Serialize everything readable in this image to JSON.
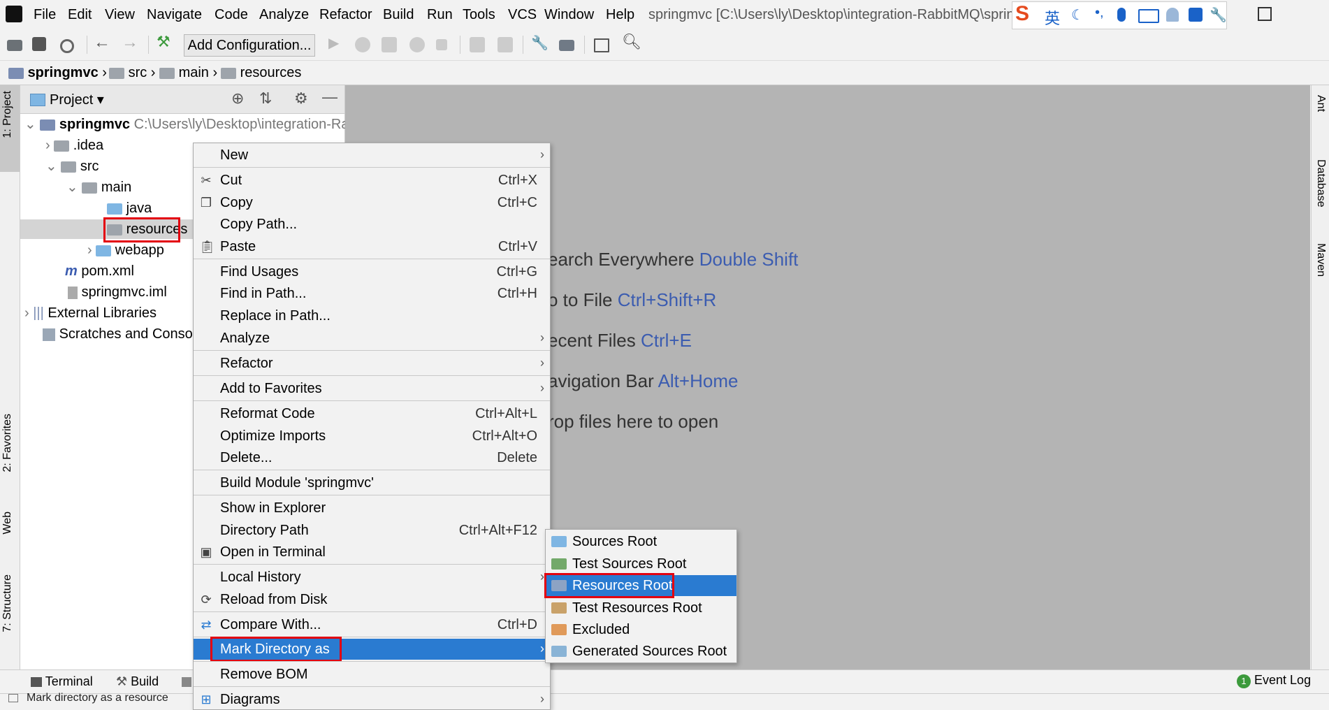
{
  "menubar": {
    "items": [
      "File",
      "Edit",
      "View",
      "Navigate",
      "Code",
      "Analyze",
      "Refactor",
      "Build",
      "Run",
      "Tools",
      "VCS",
      "Window",
      "Help"
    ],
    "window_title": "springmvc [C:\\Users\\ly\\Desktop\\integration-RabbitMQ\\sprin",
    "ime": {
      "logo": "S",
      "lang": "英"
    }
  },
  "toolbar": {
    "add_configuration": "Add Configuration..."
  },
  "breadcrumb": [
    "springmvc",
    "src",
    "main",
    "resources"
  ],
  "project_panel": {
    "title": "Project",
    "tree": {
      "root": "springmvc",
      "root_path": "C:\\Users\\ly\\Desktop\\integration-Ra",
      "idea": ".idea",
      "src": "src",
      "main": "main",
      "java": "java",
      "resources": "resources",
      "webapp": "webapp",
      "pom": "pom.xml",
      "iml": "springmvc.iml",
      "external_libraries": "External Libraries",
      "scratches": "Scratches and Console"
    }
  },
  "left_tabs": {
    "project": "1: Project",
    "favorites": "2: Favorites",
    "web": "Web",
    "structure": "7: Structure"
  },
  "right_tabs": {
    "ant": "Ant",
    "database": "Database",
    "maven": "Maven"
  },
  "editor_hints": [
    {
      "text": "earch Everywhere ",
      "key": "Double Shift"
    },
    {
      "text": "o to File ",
      "key": "Ctrl+Shift+R"
    },
    {
      "text": "ecent Files ",
      "key": "Ctrl+E"
    },
    {
      "text": "avigation Bar ",
      "key": "Alt+Home"
    },
    {
      "text": "rop files here to open",
      "key": ""
    }
  ],
  "context_menu": [
    {
      "label": "New",
      "shortcut": "",
      "submenu": true
    },
    {
      "label": "Cut",
      "shortcut": "Ctrl+X",
      "icon": "scissors-icon"
    },
    {
      "label": "Copy",
      "shortcut": "Ctrl+C",
      "icon": "copy-icon"
    },
    {
      "label": "Copy Path...",
      "shortcut": ""
    },
    {
      "label": "Paste",
      "shortcut": "Ctrl+V",
      "icon": "paste-icon"
    },
    {
      "label": "Find Usages",
      "shortcut": "Ctrl+G"
    },
    {
      "label": "Find in Path...",
      "shortcut": "Ctrl+H"
    },
    {
      "label": "Replace in Path...",
      "shortcut": ""
    },
    {
      "label": "Analyze",
      "shortcut": "",
      "submenu": true
    },
    {
      "label": "Refactor",
      "shortcut": "",
      "submenu": true
    },
    {
      "label": "Add to Favorites",
      "shortcut": "",
      "submenu": true
    },
    {
      "label": "Reformat Code",
      "shortcut": "Ctrl+Alt+L"
    },
    {
      "label": "Optimize Imports",
      "shortcut": "Ctrl+Alt+O"
    },
    {
      "label": "Delete...",
      "shortcut": "Delete"
    },
    {
      "label": "Build Module 'springmvc'",
      "shortcut": ""
    },
    {
      "label": "Show in Explorer",
      "shortcut": ""
    },
    {
      "label": "Directory Path",
      "shortcut": "Ctrl+Alt+F12"
    },
    {
      "label": "Open in Terminal",
      "shortcut": "",
      "icon": "terminal-icon"
    },
    {
      "label": "Local History",
      "shortcut": "",
      "submenu": true
    },
    {
      "label": "Reload from Disk",
      "shortcut": "",
      "icon": "reload-icon"
    },
    {
      "label": "Compare With...",
      "shortcut": "Ctrl+D",
      "icon": "compare-icon"
    },
    {
      "label": "Mark Directory as",
      "shortcut": "",
      "submenu": true,
      "selected": true
    },
    {
      "label": "Remove BOM",
      "shortcut": ""
    },
    {
      "label": "Diagrams",
      "shortcut": "",
      "submenu": true,
      "icon": "diagram-icon"
    }
  ],
  "submenu": [
    {
      "label": "Sources Root",
      "color": "#7fb6e3"
    },
    {
      "label": "Test Sources Root",
      "color": "#73a96a"
    },
    {
      "label": "Resources Root",
      "color": "#8da3c4",
      "selected": true
    },
    {
      "label": "Test Resources Root",
      "color": "#c9a26a"
    },
    {
      "label": "Excluded",
      "color": "#e09a5a"
    },
    {
      "label": "Generated Sources Root",
      "color": "#8ab4d6"
    }
  ],
  "bottom_tabs": {
    "terminal": "Terminal",
    "build": "Build",
    "event_log": "Event Log",
    "event_count": "1"
  },
  "status_text": "Mark directory as a resource"
}
